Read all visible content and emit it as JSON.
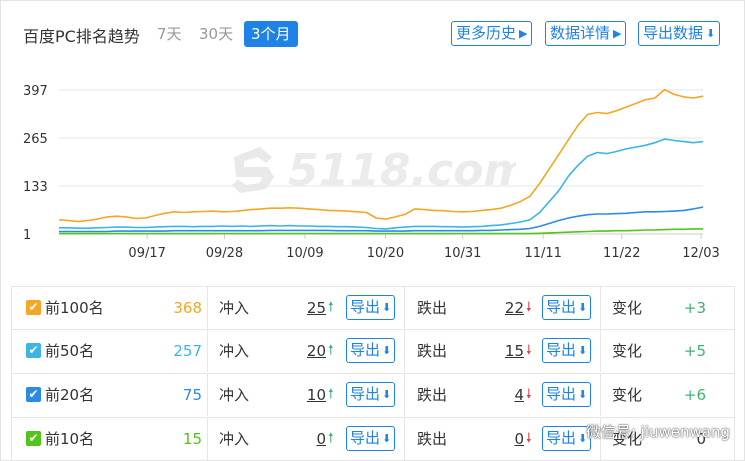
{
  "header": {
    "title": "百度PC排名趋势",
    "tabs": [
      {
        "label": "7天",
        "active": false
      },
      {
        "label": "30天",
        "active": false
      },
      {
        "label": "3个月",
        "active": true
      }
    ],
    "buttons": {
      "history": "更多历史",
      "details": "数据详情",
      "export": "导出数据"
    }
  },
  "watermark": "5118.com",
  "chart_data": {
    "type": "line",
    "y_ticks": [
      "397",
      "265",
      "133",
      "1"
    ],
    "ylim": [
      1,
      397
    ],
    "x_ticks": [
      "09/17",
      "09/28",
      "10/09",
      "10/20",
      "10/31",
      "11/11",
      "11/22",
      "12/03"
    ],
    "grid": "horizontal",
    "series": [
      {
        "color": "#f5a623",
        "values": [
          40,
          38,
          35,
          38,
          42,
          48,
          50,
          48,
          44,
          45,
          52,
          58,
          62,
          60,
          62,
          63,
          64,
          62,
          63,
          65,
          68,
          70,
          72,
          72,
          73,
          72,
          70,
          68,
          66,
          65,
          64,
          62,
          60,
          45,
          42,
          48,
          55,
          70,
          68,
          66,
          65,
          63,
          62,
          63,
          66,
          68,
          72,
          80,
          90,
          105,
          140,
          180,
          220,
          260,
          300,
          330,
          335,
          332,
          340,
          350,
          360,
          370,
          375,
          398,
          385,
          378,
          375,
          380
        ]
      },
      {
        "name": "前50名",
        "color": "#3db4e6",
        "values": [
          18,
          18,
          17,
          17,
          18,
          19,
          20,
          20,
          19,
          19,
          20,
          21,
          22,
          22,
          21,
          22,
          22,
          23,
          22,
          23,
          22,
          23,
          24,
          23,
          24,
          23,
          23,
          22,
          22,
          21,
          21,
          20,
          19,
          16,
          15,
          18,
          20,
          22,
          22,
          22,
          21,
          21,
          20,
          21,
          22,
          24,
          26,
          30,
          34,
          40,
          60,
          90,
          120,
          160,
          190,
          215,
          225,
          222,
          228,
          235,
          240,
          245,
          252,
          262,
          258,
          255,
          252,
          255
        ]
      },
      {
        "color": "#2b8ae6",
        "values": [
          8,
          8,
          8,
          8,
          8,
          8,
          9,
          9,
          9,
          9,
          9,
          9,
          10,
          10,
          10,
          10,
          10,
          10,
          10,
          10,
          10,
          10,
          11,
          11,
          11,
          11,
          11,
          11,
          11,
          10,
          10,
          10,
          10,
          9,
          9,
          9,
          9,
          10,
          10,
          10,
          10,
          10,
          10,
          10,
          11,
          11,
          12,
          13,
          14,
          16,
          22,
          30,
          38,
          45,
          50,
          54,
          56,
          56,
          57,
          58,
          60,
          62,
          62,
          63,
          64,
          66,
          70,
          75
        ]
      },
      {
        "color": "#52c41a",
        "values": [
          2,
          2,
          2,
          2,
          2,
          2,
          2,
          2,
          2,
          2,
          2,
          2,
          2,
          2,
          2,
          2,
          2,
          2,
          2,
          2,
          2,
          2,
          2,
          2,
          2,
          2,
          2,
          2,
          2,
          2,
          2,
          2,
          2,
          2,
          2,
          2,
          2,
          2,
          2,
          2,
          2,
          2,
          2,
          2,
          2,
          2,
          2,
          2,
          2,
          2,
          3,
          4,
          5,
          6,
          7,
          8,
          9,
          9,
          10,
          10,
          11,
          12,
          12,
          13,
          14,
          14,
          15,
          15
        ]
      }
    ]
  },
  "table": {
    "rows": [
      {
        "label": "前100名",
        "count": "368",
        "color": "#f5a623",
        "in_label": "冲入",
        "in_value": "25",
        "out_label": "跌出",
        "out_value": "22",
        "export_label": "导出",
        "change_label": "变化",
        "change_value": "+3"
      },
      {
        "label": "前50名",
        "count": "257",
        "color": "#3db4e6",
        "in_label": "冲入",
        "in_value": "20",
        "out_label": "跌出",
        "out_value": "15",
        "export_label": "导出",
        "change_label": "变化",
        "change_value": "+5"
      },
      {
        "label": "前20名",
        "count": "75",
        "color": "#2b8ae6",
        "in_label": "冲入",
        "in_value": "10",
        "out_label": "跌出",
        "out_value": "4",
        "export_label": "导出",
        "change_label": "变化",
        "change_value": "+6"
      },
      {
        "label": "前10名",
        "count": "15",
        "color": "#52c41a",
        "in_label": "冲入",
        "in_value": "0",
        "out_label": "跌出",
        "out_value": "0",
        "export_label": "导出",
        "change_label": "变化",
        "change_value": "0"
      }
    ]
  },
  "wechat_watermark": "微信号: jiuwenwang",
  "icons": {
    "check": "check-icon",
    "arrow_up": "arrow-up-icon",
    "arrow_down": "arrow-down-icon",
    "play": "play-icon",
    "download": "download-icon"
  }
}
